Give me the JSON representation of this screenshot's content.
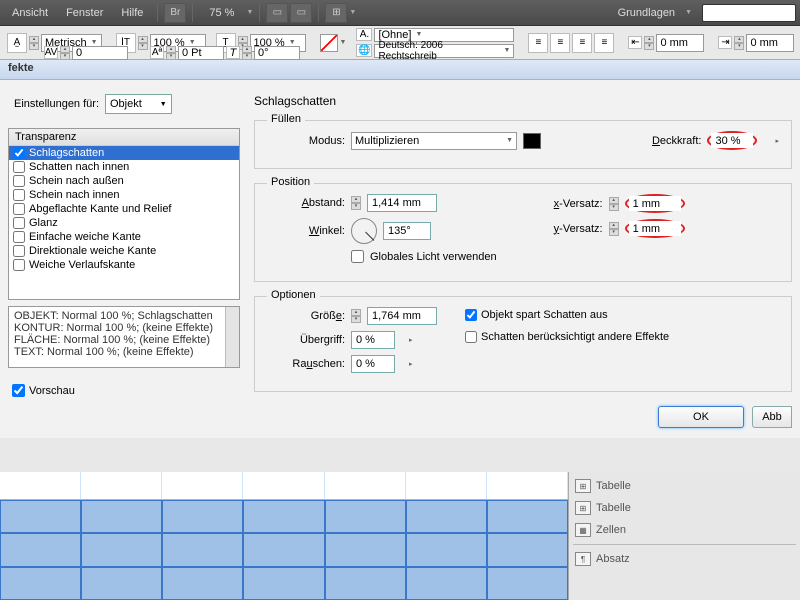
{
  "menubar": {
    "ansicht": "Ansicht",
    "fenster": "Fenster",
    "hilfe": "Hilfe"
  },
  "topbar": {
    "zoom": "75 %",
    "layout_label": "Grundlagen"
  },
  "toolbar": {
    "metric": "Metrisch",
    "pct100a": "100 %",
    "pct100b": "100 %",
    "zero_pt": "0 Pt",
    "zero_deg": "0°",
    "ohne": "[Ohne]",
    "lang": "Deutsch: 2006 Rechtschreib",
    "zero_mm1": "0 mm",
    "zero_mm2": "0 mm"
  },
  "dialog": {
    "title": "fekte",
    "einst_label": "Einstellungen für:",
    "einst_value": "Objekt",
    "list_header": "Transparenz",
    "items": [
      "Schlagschatten",
      "Schatten nach innen",
      "Schein nach außen",
      "Schein nach innen",
      "Abgeflachte Kante und Relief",
      "Glanz",
      "Einfache weiche Kante",
      "Direktionale weiche Kante",
      "Weiche Verlaufskante"
    ],
    "info1": "OBJEKT: Normal 100 %; Schlagschatten",
    "info2": "KONTUR: Normal 100 %; (keine Effekte)",
    "info3": "FLÄCHE: Normal 100 %; (keine Effekte)",
    "info4": "TEXT: Normal 100 %; (keine Effekte)",
    "vorschau": "Vorschau",
    "heading": "Schlagschatten",
    "fuellen": "Füllen",
    "modus": "Modus:",
    "modus_val": "Multiplizieren",
    "deckkraft": "Deckkraft:",
    "deckkraft_val": "30 %",
    "position": "Position",
    "abstand": "Abstand:",
    "abstand_val": "1,414 mm",
    "winkel": "Winkel:",
    "winkel_val": "135°",
    "xvers": "x-Versatz:",
    "xvers_val": "1 mm",
    "yvers": "y-Versatz:",
    "yvers_val": "1 mm",
    "globales": "Globales Licht verwenden",
    "optionen": "Optionen",
    "groesse": "Größe:",
    "groesse_val": "1,764 mm",
    "uebergriff": "Übergriff:",
    "uebergriff_val": "0 %",
    "rauschen": "Rauschen:",
    "rauschen_val": "0 %",
    "objspart": "Objekt spart Schatten aus",
    "schatten_ber": "Schatten berücksichtigt andere Effekte",
    "ok": "OK",
    "abbr": "Abb"
  },
  "rpanel": {
    "i1": "Tabelle",
    "i2": "Tabelle",
    "i3": "Zellen",
    "i4": "Absatz"
  }
}
